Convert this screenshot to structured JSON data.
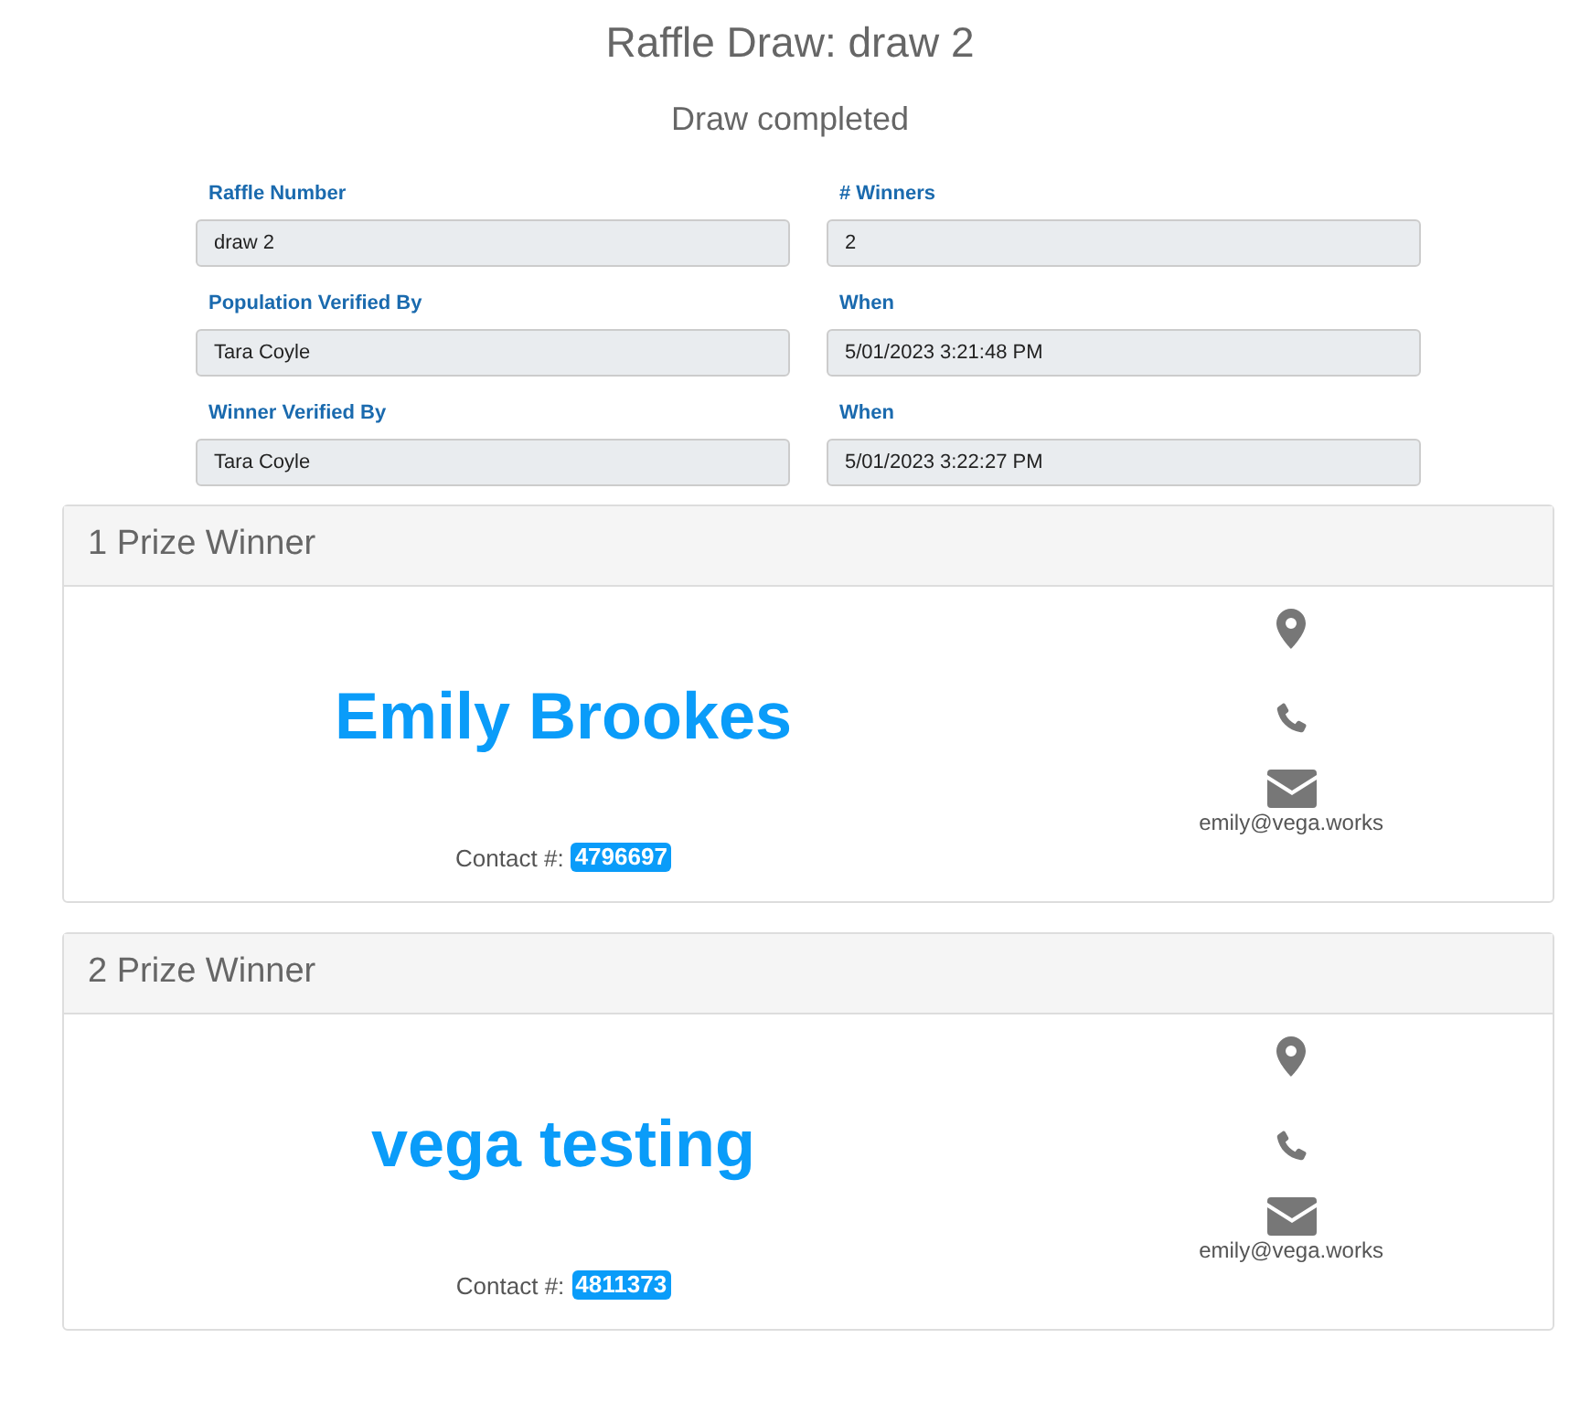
{
  "title": "Raffle Draw: draw 2",
  "subtitle": "Draw completed",
  "fields": [
    {
      "label": "Raffle Number",
      "value": "draw 2"
    },
    {
      "label": "# Winners",
      "value": "2"
    },
    {
      "label": "Population Verified By",
      "value": "Tara Coyle"
    },
    {
      "label": "When",
      "value": "5/01/2023 3:21:48 PM"
    },
    {
      "label": "Winner Verified By",
      "value": "Tara Coyle"
    },
    {
      "label": "When",
      "value": "5/01/2023 3:22:27 PM"
    }
  ],
  "winners": [
    {
      "heading": "1 Prize Winner",
      "name": "Emily Brookes",
      "contact_label": "Contact #:",
      "contact_number": "4796697",
      "email": "emily@vega.works"
    },
    {
      "heading": "2 Prize Winner",
      "name": "vega testing",
      "contact_label": "Contact #:",
      "contact_number": "4811373",
      "email": "emily@vega.works"
    }
  ]
}
